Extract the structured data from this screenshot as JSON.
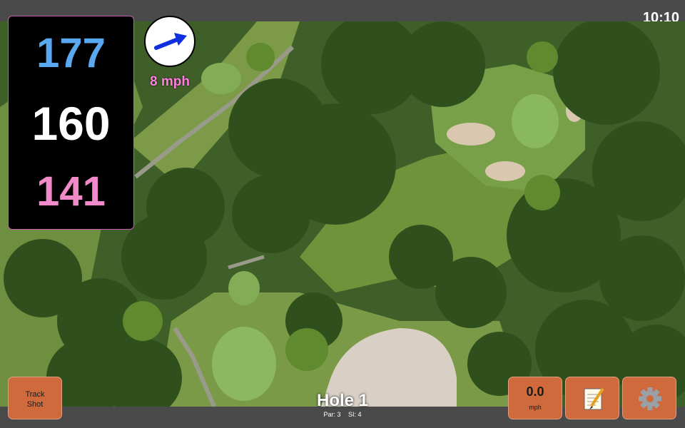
{
  "status": {
    "time": "10:10"
  },
  "yardage": {
    "back": "177",
    "center": "160",
    "front": "141"
  },
  "wind": {
    "speed": "8 mph",
    "icon": "wind-arrow-icon"
  },
  "buttons": {
    "track_shot_line1": "Track",
    "track_shot_line2": "Shot",
    "speed_value": "0.0",
    "speed_unit": "mph",
    "notes_icon": "notepad-icon",
    "settings_icon": "gear-icon"
  },
  "hole": {
    "title": "Hole 1",
    "par": "Par: 3",
    "si": "SI: 4"
  },
  "colors": {
    "back": "#5aa8f0",
    "center": "#ffffff",
    "front": "#f08ac8",
    "wind_text": "#ff7ee0",
    "button": "#cf6a3d"
  }
}
